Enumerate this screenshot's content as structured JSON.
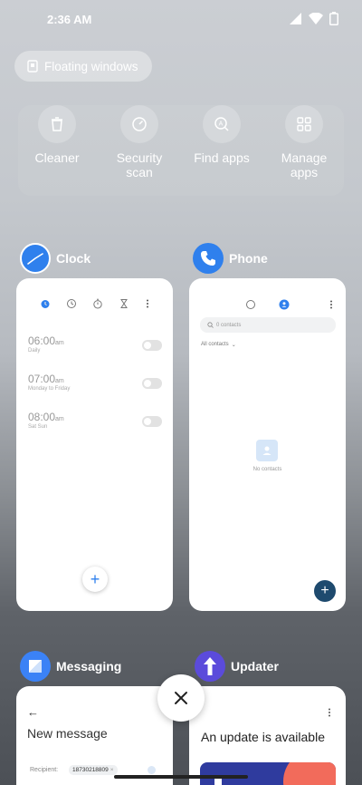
{
  "status": {
    "time": "2:36 AM"
  },
  "floating_windows": {
    "label": "Floating windows"
  },
  "shortcuts": [
    {
      "label": "Cleaner",
      "icon": "trash-icon"
    },
    {
      "label": "Security scan",
      "icon": "security-scan-icon"
    },
    {
      "label": "Find apps",
      "icon": "find-apps-icon"
    },
    {
      "label": "Manage apps",
      "icon": "manage-apps-icon"
    }
  ],
  "shortcut_labels": {
    "cleaner": "Cleaner",
    "security_1": "Security",
    "security_2": "scan",
    "find": "Find apps",
    "manage_1": "Manage",
    "manage_2": "apps"
  },
  "recent_apps": {
    "clock": {
      "title": "Clock",
      "alarms": [
        {
          "time": "06:00",
          "ampm": "am",
          "repeat": "Daily"
        },
        {
          "time": "07:00",
          "ampm": "am",
          "repeat": "Monday to Friday"
        },
        {
          "time": "08:00",
          "ampm": "am",
          "repeat": "Sat Sun"
        }
      ]
    },
    "phone": {
      "title": "Phone",
      "search_placeholder": "0 contacts",
      "filter": "All contacts",
      "empty_text": "No contacts"
    },
    "messaging": {
      "title": "Messaging",
      "heading": "New message",
      "recipient_label": "Recipient:",
      "recipient_value": "18730218809"
    },
    "updater": {
      "title": "Updater",
      "heading": "An update is available"
    }
  },
  "colors": {
    "accent": "#2f80ed",
    "phone_fab": "#1e4a6e",
    "messaging_icon": "#3b82f6",
    "updater_icon": "#5b4bdb"
  }
}
